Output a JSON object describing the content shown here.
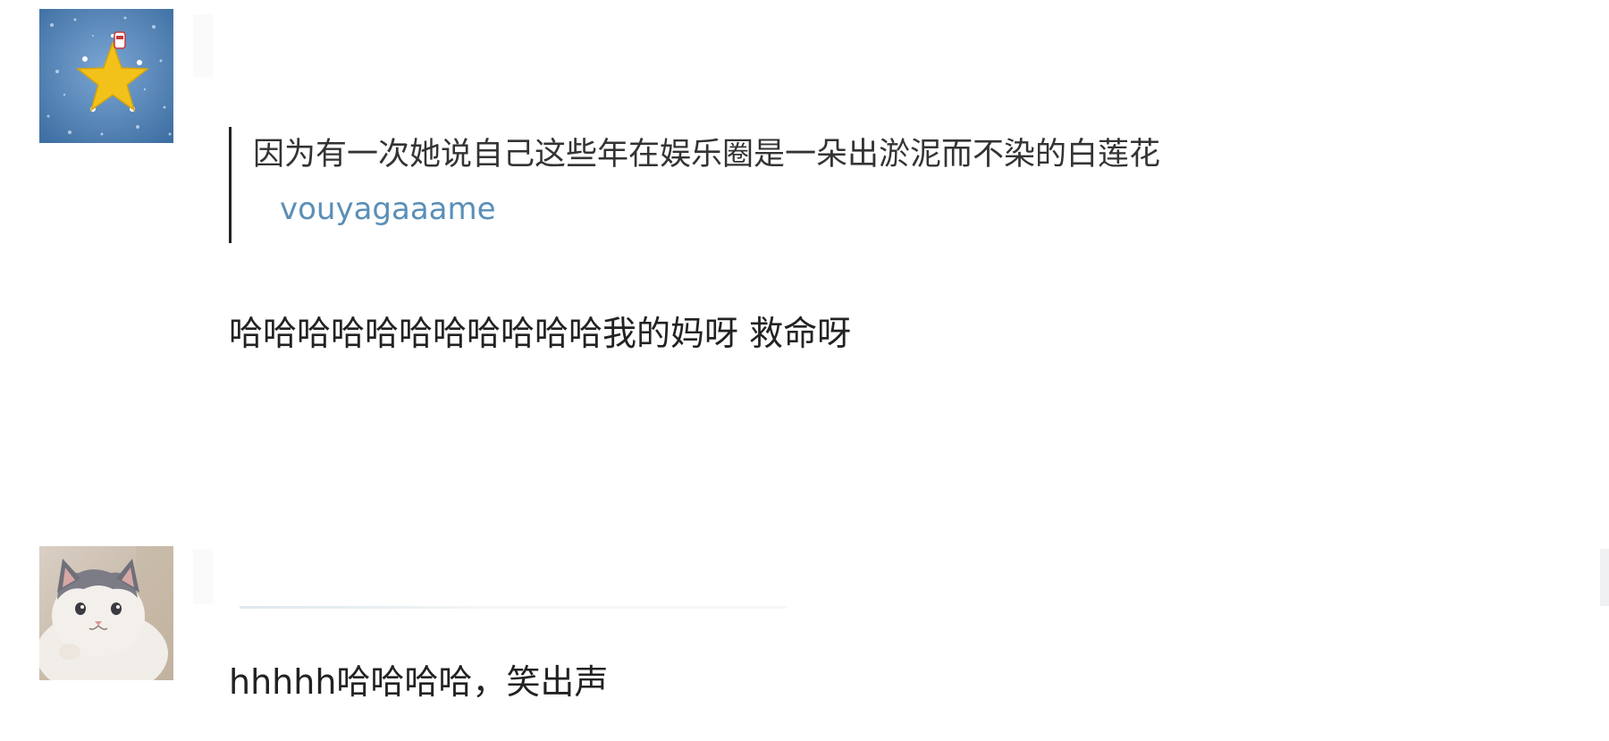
{
  "comments": [
    {
      "avatar_icon": "star-avatar-icon",
      "quote": {
        "text": "因为有一次她说自己这些年在娱乐圈是一朵出淤泥而不染的白莲花",
        "author": "vouyagaaame"
      },
      "body": "哈哈哈哈哈哈哈哈哈哈哈我的妈呀 救命呀"
    },
    {
      "avatar_icon": "cat-avatar-icon",
      "body": "hhhhh哈哈哈哈，笑出声"
    }
  ],
  "colors": {
    "author_link": "#5a8fb8",
    "quote_bar": "#222222",
    "avatar_star_bg": "#5b8cc0",
    "star": "#f2c21a"
  }
}
